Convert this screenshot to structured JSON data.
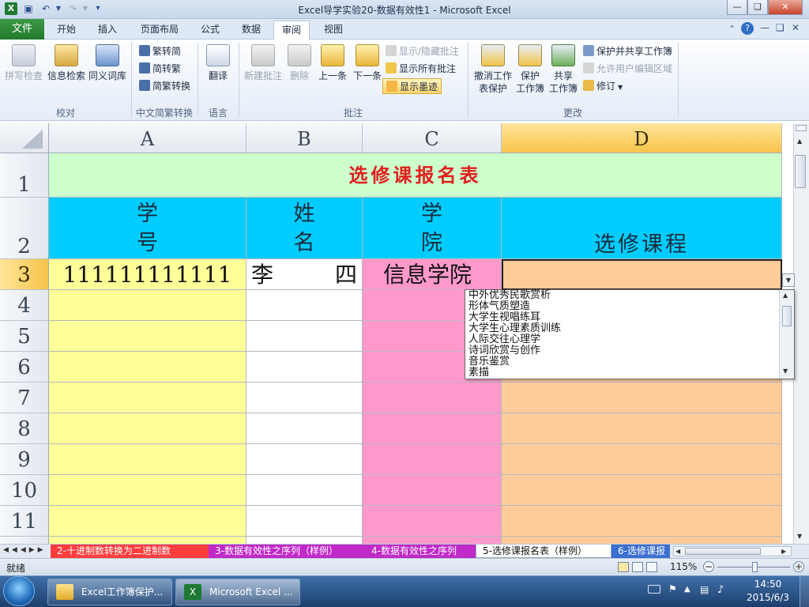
{
  "window": {
    "title": "Excel导学实验20-数据有效性1 - Microsoft Excel",
    "qa_icons": [
      "excel-icon",
      "save-icon",
      "undo-icon",
      "redo-icon",
      "customize-icon"
    ]
  },
  "tabs": {
    "file": "文件",
    "items": [
      "开始",
      "插入",
      "页面布局",
      "公式",
      "数据",
      "审阅",
      "视图"
    ],
    "active": "审阅"
  },
  "ribbon": {
    "proofing": {
      "label": "校对",
      "spell": "拼写检查",
      "research": "信息检索",
      "thesaurus": "同义词库"
    },
    "chinese": {
      "label": "中文简繁转换",
      "to_simplified": "繁转简",
      "to_traditional": "简转繁",
      "convert": "简繁转换"
    },
    "language": {
      "label": "语言",
      "translate": "翻译"
    },
    "comments": {
      "label": "批注",
      "new": "新建批注",
      "delete": "删除",
      "prev": "上一条",
      "next": "下一条",
      "show_hide": "显示/隐藏批注",
      "show_all": "显示所有批注",
      "show_ink": "显示墨迹"
    },
    "changes": {
      "label": "更改",
      "unprotect_sheet_1": "撤消工作",
      "unprotect_sheet_2": "表保护",
      "protect_wb_1": "保护",
      "protect_wb_2": "工作簿",
      "share_wb_1": "共享",
      "share_wb_2": "工作簿",
      "protect_share": "保护并共享工作簿",
      "allow_edit": "允许用户编辑区域",
      "track": "修订"
    }
  },
  "grid": {
    "columns": [
      "A",
      "B",
      "C",
      "D"
    ],
    "selected_column": "D",
    "rows": [
      "1",
      "2",
      "3",
      "4",
      "5",
      "6",
      "7",
      "8",
      "9",
      "10",
      "11"
    ],
    "selected_row": "3",
    "title": "选修课报名表",
    "headers": {
      "a_line1": "学",
      "a_line2": "号",
      "b_line1": "姓",
      "b_line2": "名",
      "c_line1": "学",
      "c_line2": "院",
      "d": "选修课程"
    },
    "row3": {
      "a": "111111111111",
      "b_surname": "李",
      "b_given": "四",
      "c": "信息学院",
      "d": ""
    }
  },
  "dropdown": {
    "options": [
      "中外优秀民歌赏析",
      "形体气质塑造",
      "大学生视唱练耳",
      "大学生心理素质训练",
      "人际交往心理学",
      "诗词欣赏与创作",
      "音乐鉴赏",
      "素描"
    ]
  },
  "sheets": {
    "tabs": [
      "2-十进制数转换为二进制数",
      "3-数据有效性之序列（样例）",
      "4-数据有效性之序列",
      "5-选修课报名表（样例）",
      "6-选修课报"
    ],
    "active_index": 3
  },
  "status": {
    "ready": "就绪",
    "zoom": "115%"
  },
  "taskbar": {
    "btn1": "Excel工作簿保护...",
    "btn2": "Microsoft Excel ...",
    "time": "14:50",
    "date": "2015/6/3"
  },
  "colors": {
    "title_bg": "#ccffcc",
    "title_fg": "#e02020",
    "header_bg": "#00ccff",
    "col_a": "#ffff99",
    "col_b": "#ffffff",
    "col_c": "#ff99cc",
    "col_d": "#ffcc99"
  }
}
